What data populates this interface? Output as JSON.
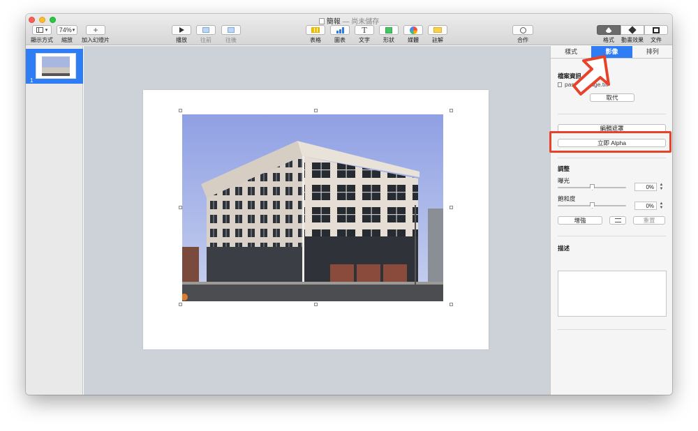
{
  "window": {
    "title": "簡報",
    "status": "— 尚未儲存"
  },
  "toolbar": {
    "view_label": "顯示方式",
    "zoom_value": "74%",
    "zoom_label": "縮放",
    "add_slide_label": "加入幻燈片",
    "play_label": "播放",
    "backward_label": "往前",
    "forward_label": "往後",
    "table_label": "表格",
    "chart_label": "圖表",
    "text_label": "文字",
    "shape_label": "形狀",
    "media_label": "媒體",
    "comment_label": "註解",
    "collaborate_label": "合作",
    "format_label": "格式",
    "animate_label": "動畫效果",
    "document_label": "文件",
    "text_glyph": "T",
    "add_glyph": "+"
  },
  "navigator": {
    "slide_number": "1"
  },
  "inspector": {
    "tabs": [
      "樣式",
      "影像",
      "排列"
    ],
    "file_info_title": "檔案資訊",
    "file_name": "pasted-image.tiff",
    "replace_button": "取代",
    "edit_mask_button": "編輯遮罩",
    "instant_alpha_button": "立即 Alpha",
    "adjust_title": "調整",
    "exposure_label": "曝光",
    "exposure_value": "0%",
    "saturation_label": "飽和度",
    "saturation_value": "0%",
    "enhance_button": "增強",
    "reset_button": "重置",
    "description_title": "描述"
  },
  "colors": {
    "accent": "#2f7df5",
    "callout": "#e7432b"
  },
  "icons": [
    "view-icon",
    "play-icon",
    "backward-icon",
    "forward-icon",
    "table-icon",
    "chart-icon",
    "text-icon",
    "shape-icon",
    "media-icon",
    "comment-icon",
    "collaborate-icon",
    "format-brush-icon",
    "animate-icon",
    "document-icon",
    "adjust-sliders-icon",
    "callout-arrow-icon"
  ]
}
